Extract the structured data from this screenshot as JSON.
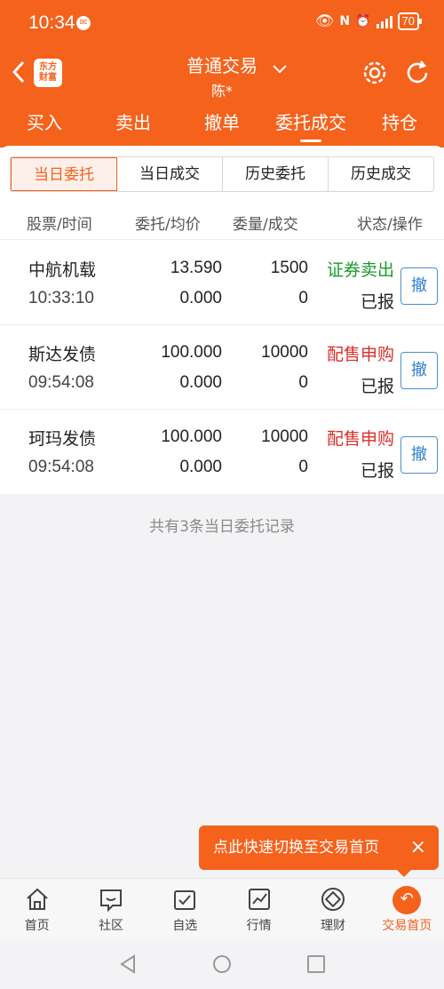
{
  "status_bar": {
    "time": "10:34",
    "battery": "70"
  },
  "header": {
    "title": "普通交易",
    "subtitle": "陈*",
    "logo_text": "东方财富"
  },
  "tabs": [
    {
      "label": "买入"
    },
    {
      "label": "卖出"
    },
    {
      "label": "撤单"
    },
    {
      "label": "委托成交"
    },
    {
      "label": "持仓"
    }
  ],
  "segments": [
    {
      "label": "当日委托"
    },
    {
      "label": "当日成交"
    },
    {
      "label": "历史委托"
    },
    {
      "label": "历史成交"
    }
  ],
  "columns": {
    "stock_time": "股票/时间",
    "price": "委托/均价",
    "qty": "委量/成交",
    "status": "状态/操作"
  },
  "orders": [
    {
      "name": "中航机载",
      "time": "10:33:10",
      "order_price": "13.590",
      "avg_price": "0.000",
      "order_qty": "1500",
      "filled_qty": "0",
      "type": "证券卖出",
      "status": "已报",
      "action": "撤"
    },
    {
      "name": "斯达发债",
      "time": "09:54:08",
      "order_price": "100.000",
      "avg_price": "0.000",
      "order_qty": "10000",
      "filled_qty": "0",
      "type": "配售申购",
      "status": "已报",
      "action": "撤"
    },
    {
      "name": "珂玛发债",
      "time": "09:54:08",
      "order_price": "100.000",
      "avg_price": "0.000",
      "order_qty": "10000",
      "filled_qty": "0",
      "type": "配售申购",
      "status": "已报",
      "action": "撤"
    }
  ],
  "summary": "共有3条当日委托记录",
  "toast": {
    "text": "点此快速切换至交易首页",
    "close": "×"
  },
  "bottom_nav": [
    {
      "label": "首页",
      "icon": "home-icon"
    },
    {
      "label": "社区",
      "icon": "community-icon"
    },
    {
      "label": "自选",
      "icon": "watchlist-icon"
    },
    {
      "label": "行情",
      "icon": "market-icon"
    },
    {
      "label": "理财",
      "icon": "finance-icon"
    },
    {
      "label": "交易首页",
      "icon": "trade-home-icon"
    }
  ],
  "colors": {
    "brand": "#f4621c",
    "sell": "#1a9b2c",
    "subscribe": "#d9302b",
    "cancel": "#2f7fd0"
  }
}
